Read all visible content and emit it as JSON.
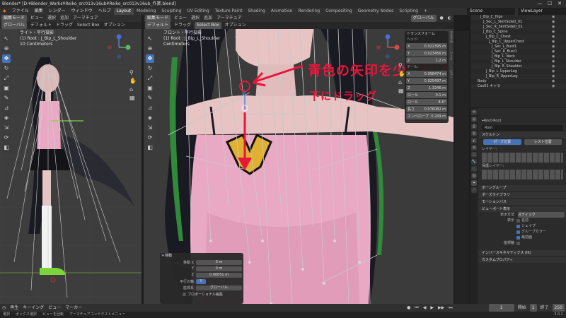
{
  "window": {
    "title": "Blender* [D:¥Blender_Works¥Reiko_src013v16ub¥Reiko_src013v16ub_作業.blend]",
    "controls": [
      "—",
      "☐",
      "✕"
    ]
  },
  "menu": {
    "items": [
      "ファイル",
      "編集",
      "レンダー",
      "ウィンドウ",
      "ヘルプ"
    ],
    "workspaces": [
      "Layout",
      "Modeling",
      "Sculpting",
      "UV Editing",
      "Texture Paint",
      "Shading",
      "Animation",
      "Rendering",
      "Compositing",
      "Geometry Nodes",
      "Scripting"
    ],
    "active_workspace": "Layout",
    "scene": "Scene",
    "view_layer": "ViewLayer"
  },
  "left_viewport": {
    "header": [
      "編集モード",
      "ビュー",
      "選択",
      "追加",
      "アーマチュア"
    ],
    "header_right": [
      "グローバル",
      "デフォルト",
      "ドラッグ",
      "Select Box",
      "オプション"
    ],
    "overlay_line1": "ライト・平行投影",
    "overlay_line2": "(1) Root : J_Bip_L_Shoulder",
    "overlay_line3": "10 Centimeters"
  },
  "main_viewport": {
    "header": [
      "編集モード",
      "ビュー",
      "選択",
      "追加",
      "アーマチュア"
    ],
    "header_right": [
      "グローバル",
      "デフォルト",
      "ドラッグ",
      "Select Box",
      "オプション"
    ],
    "overlay_line1": "フロント・平行投影",
    "overlay_line2": "(1) Root : J_Bip_L_Shoulder",
    "overlay_line3": "Centimeters",
    "annotation1": "青色の矢印を少しだけ",
    "annotation2": "下にドラッグ"
  },
  "npanel": {
    "title": "トランスフォーム",
    "head_label": "ヘッド:",
    "tail_label": "テール:",
    "tab_labels": [
      "アイテム",
      "ツール",
      "ビュー"
    ],
    "rows": [
      {
        "label": "X",
        "value": "0.022395 m"
      },
      {
        "label": "Y",
        "value": "0.023456 m"
      },
      {
        "label": "Z",
        "value": "1.2 m"
      },
      {
        "label": "X",
        "value": "0.098474 m"
      },
      {
        "label": "Y",
        "value": "0.025497 m"
      },
      {
        "label": "Z",
        "value": "1.3246 m"
      },
      {
        "label": "ロール",
        "value": "0.1 m"
      },
      {
        "label": "ロール",
        "value": "8.6°"
      },
      {
        "label": "長さ",
        "value": "0.076082 m"
      },
      {
        "label": "エンベロープ",
        "value": "0.249 m"
      }
    ]
  },
  "operator_panel": {
    "title": "移動",
    "rows": [
      {
        "label": "移動 X",
        "value": "0 m"
      },
      {
        "label": "Y",
        "value": "0 m"
      },
      {
        "label": "Z",
        "value": "0.00051 m"
      },
      {
        "label": "平行の軸",
        "value": "X"
      },
      {
        "label": "座標系",
        "value": "グローバル"
      }
    ],
    "checkbox": "プロポーショナル編集"
  },
  "outliner": {
    "rows": [
      "J_Bip_C_Hips",
      "J_Sec_L_SkirtSide0_01",
      "J_Sec_R_SkirtSide0_01",
      "J_Bip_C_Spine",
      "J_Bip_C_Chest",
      "J_Bip_C_UpperChest",
      "J_Sec_L_Bust1",
      "J_Sec_R_Bust1",
      "J_Bip_C_Neck",
      "J_Bip_L_Shoulder",
      "J_Bip_R_Shoulder",
      "J_Bip_L_UpperLeg",
      "J_Bip_R_UpperLeg",
      "Body",
      "Cos01 キャラ"
    ]
  },
  "properties": {
    "breadcrumb": [
      "Root",
      "Root"
    ],
    "name_field": "Root",
    "sections": {
      "skeleton": "スケルトン",
      "pose_position": "ポーズ位置",
      "rest_position": "レスト位置",
      "layers": "レイヤー:",
      "protected_layers": "保護レイヤー:",
      "bone_groups": "ボーングループ",
      "pose_library": "ポーズライブラリ",
      "motion_paths": "モーションパス",
      "viewport_display": "ビューポート表示",
      "display_as_label": "表示方法",
      "display_as_value": "スティック",
      "show_label": "表示",
      "names": "名前",
      "shapes": "シェイプ",
      "group_colors": "グループカラー",
      "in_front": "最前面",
      "axes": "座標軸",
      "ik": "インバースキネマティクス (IK)",
      "custom_props": "カスタムプロパティ"
    }
  },
  "timeline": {
    "items": [
      "再生",
      "キーイング",
      "ビュー",
      "マーカー"
    ],
    "current_frame": "1",
    "start_label": "開始",
    "start": "1",
    "end_label": "終了",
    "end": "250"
  },
  "status": {
    "items": [
      "選択",
      "ボックス選択",
      "ビューを回転",
      "アーマチュアコンテクストメニュー"
    ],
    "version": "3.0.1"
  },
  "colors": {
    "annotation_red": "#e8163a",
    "accent_blue": "#4772b3",
    "skin": "#e7c3c3",
    "dress_pink": "#e9a9c4",
    "hair": "#1a1a22"
  }
}
